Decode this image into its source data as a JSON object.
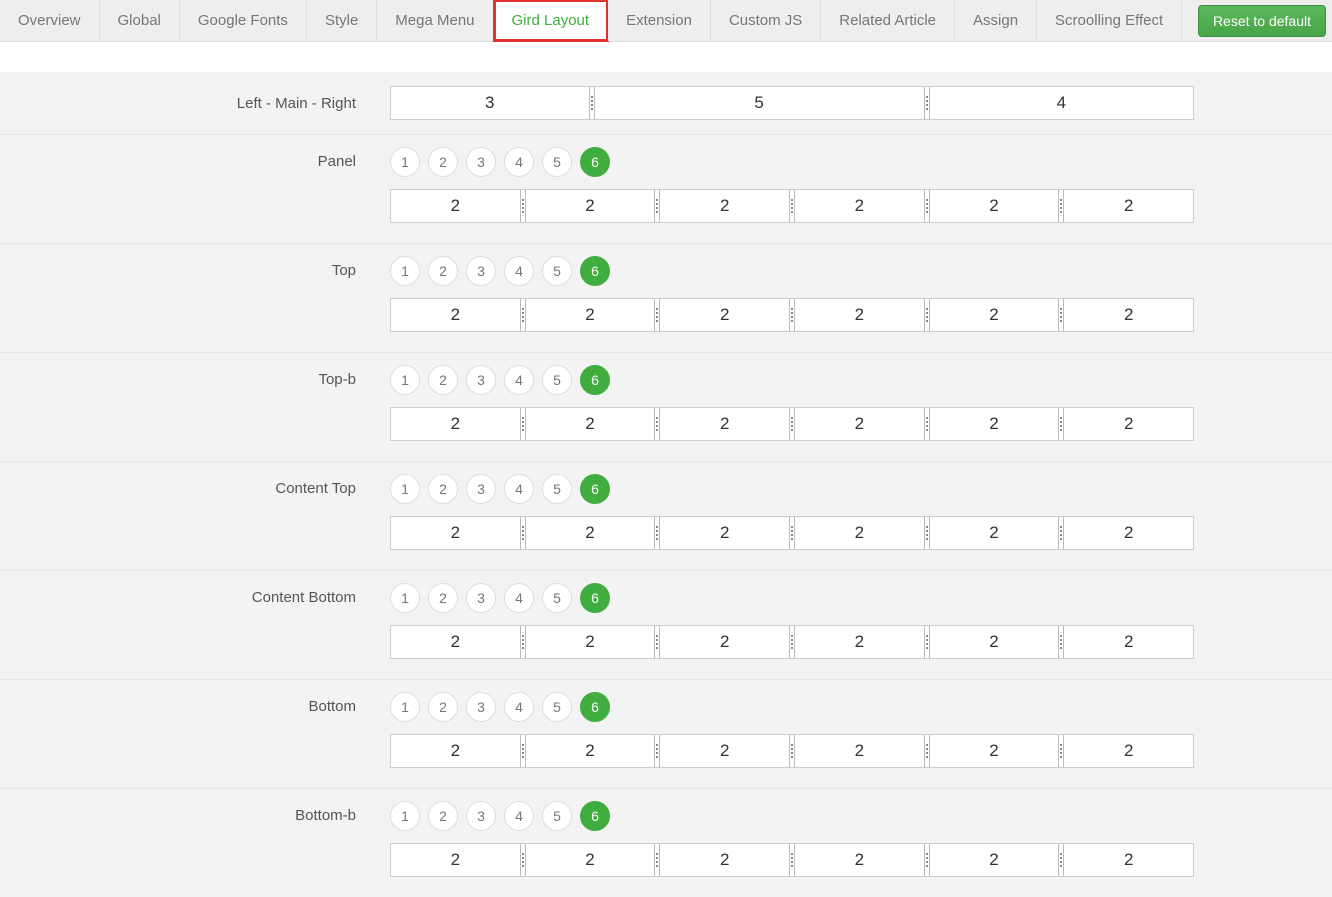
{
  "tabs": [
    {
      "label": "Overview",
      "active": false
    },
    {
      "label": "Global",
      "active": false
    },
    {
      "label": "Google Fonts",
      "active": false
    },
    {
      "label": "Style",
      "active": false
    },
    {
      "label": "Mega Menu",
      "active": false
    },
    {
      "label": "Gird Layout",
      "active": true,
      "highlight": true
    },
    {
      "label": "Extension",
      "active": false
    },
    {
      "label": "Custom JS",
      "active": false
    },
    {
      "label": "Related Article",
      "active": false
    },
    {
      "label": "Assign",
      "active": false
    },
    {
      "label": "Scroolling Effect",
      "active": false
    }
  ],
  "reset_label": "Reset to default",
  "rows": [
    {
      "label": "Left - Main - Right",
      "type": "simple",
      "cells": [
        3,
        5,
        4
      ]
    },
    {
      "label": "Panel",
      "type": "counted",
      "count": 6,
      "cells": [
        2,
        2,
        2,
        2,
        2,
        2
      ]
    },
    {
      "label": "Top",
      "type": "counted",
      "count": 6,
      "cells": [
        2,
        2,
        2,
        2,
        2,
        2
      ]
    },
    {
      "label": "Top-b",
      "type": "counted",
      "count": 6,
      "cells": [
        2,
        2,
        2,
        2,
        2,
        2
      ]
    },
    {
      "label": "Content Top",
      "type": "counted",
      "count": 6,
      "cells": [
        2,
        2,
        2,
        2,
        2,
        2
      ]
    },
    {
      "label": "Content Bottom",
      "type": "counted",
      "count": 6,
      "cells": [
        2,
        2,
        2,
        2,
        2,
        2
      ]
    },
    {
      "label": "Bottom",
      "type": "counted",
      "count": 6,
      "cells": [
        2,
        2,
        2,
        2,
        2,
        2
      ]
    },
    {
      "label": "Bottom-b",
      "type": "counted",
      "count": 6,
      "cells": [
        2,
        2,
        2,
        2,
        2,
        2
      ]
    }
  ],
  "pill_options": [
    1,
    2,
    3,
    4,
    5,
    6
  ]
}
